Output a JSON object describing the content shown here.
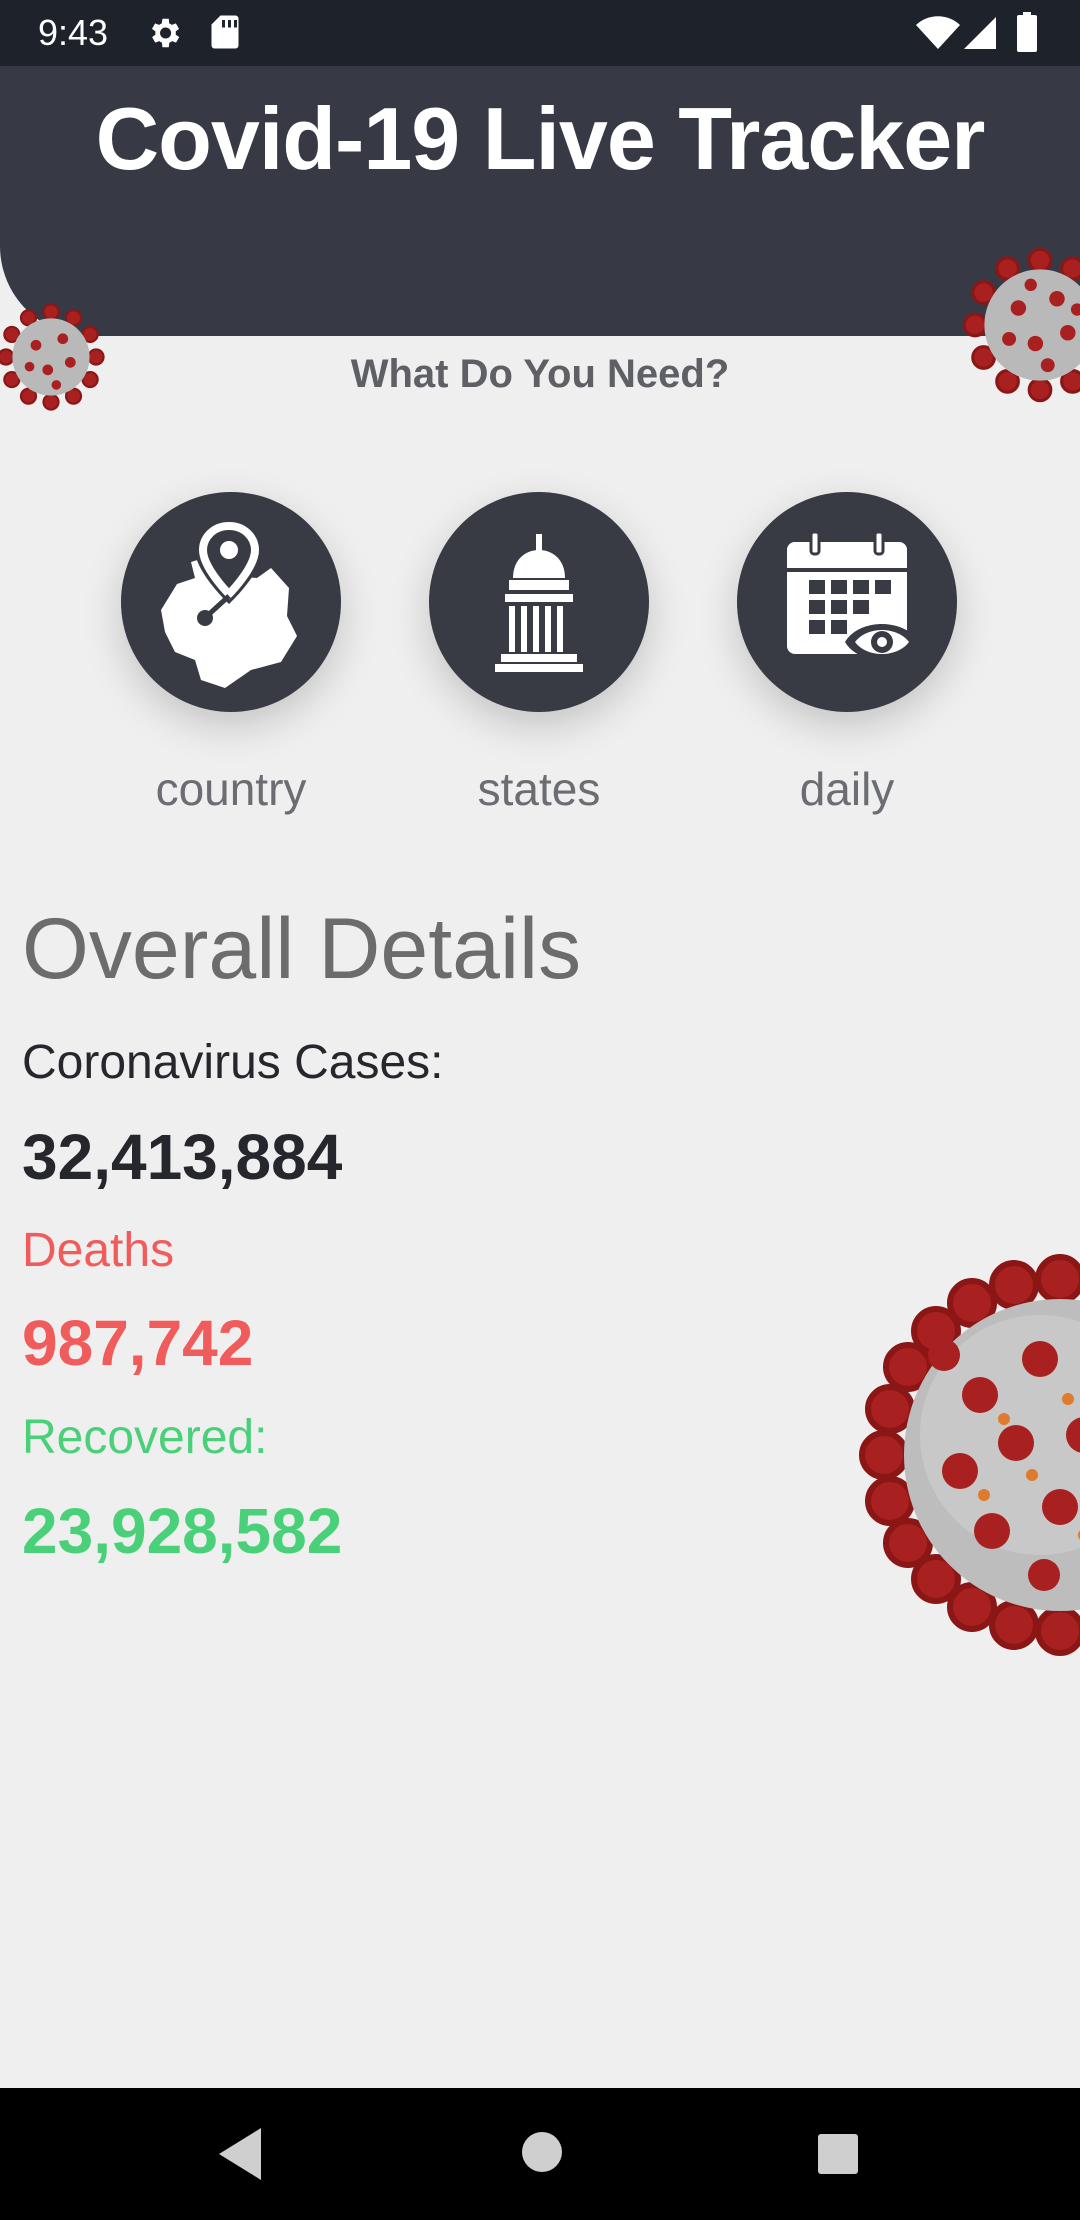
{
  "status_bar": {
    "time": "9:43",
    "icons": [
      "gear-icon",
      "sd-card-icon",
      "wifi-icon",
      "signal-icon",
      "battery-icon"
    ]
  },
  "header": {
    "title": "Covid-19 Live Tracker"
  },
  "subtitle": "What Do You Need?",
  "menu": [
    {
      "label": "country",
      "icon": "country-map-pin-icon"
    },
    {
      "label": "states",
      "icon": "capitol-building-icon"
    },
    {
      "label": "daily",
      "icon": "calendar-eye-icon"
    }
  ],
  "overall": {
    "title": "Overall Details",
    "cases_label": "Coronavirus Cases:",
    "cases_value": "32,413,884",
    "deaths_label": "Deaths",
    "deaths_value": "987,742",
    "recovered_label": "Recovered:",
    "recovered_value": "23,928,582"
  },
  "colors": {
    "header": "#373a44",
    "background": "#efefef",
    "deaths": "#f05b5b",
    "recovered": "#4bd07a",
    "virus_spike": "#a8201f"
  },
  "nav_bar": [
    "back-icon",
    "home-icon",
    "recents-icon"
  ]
}
